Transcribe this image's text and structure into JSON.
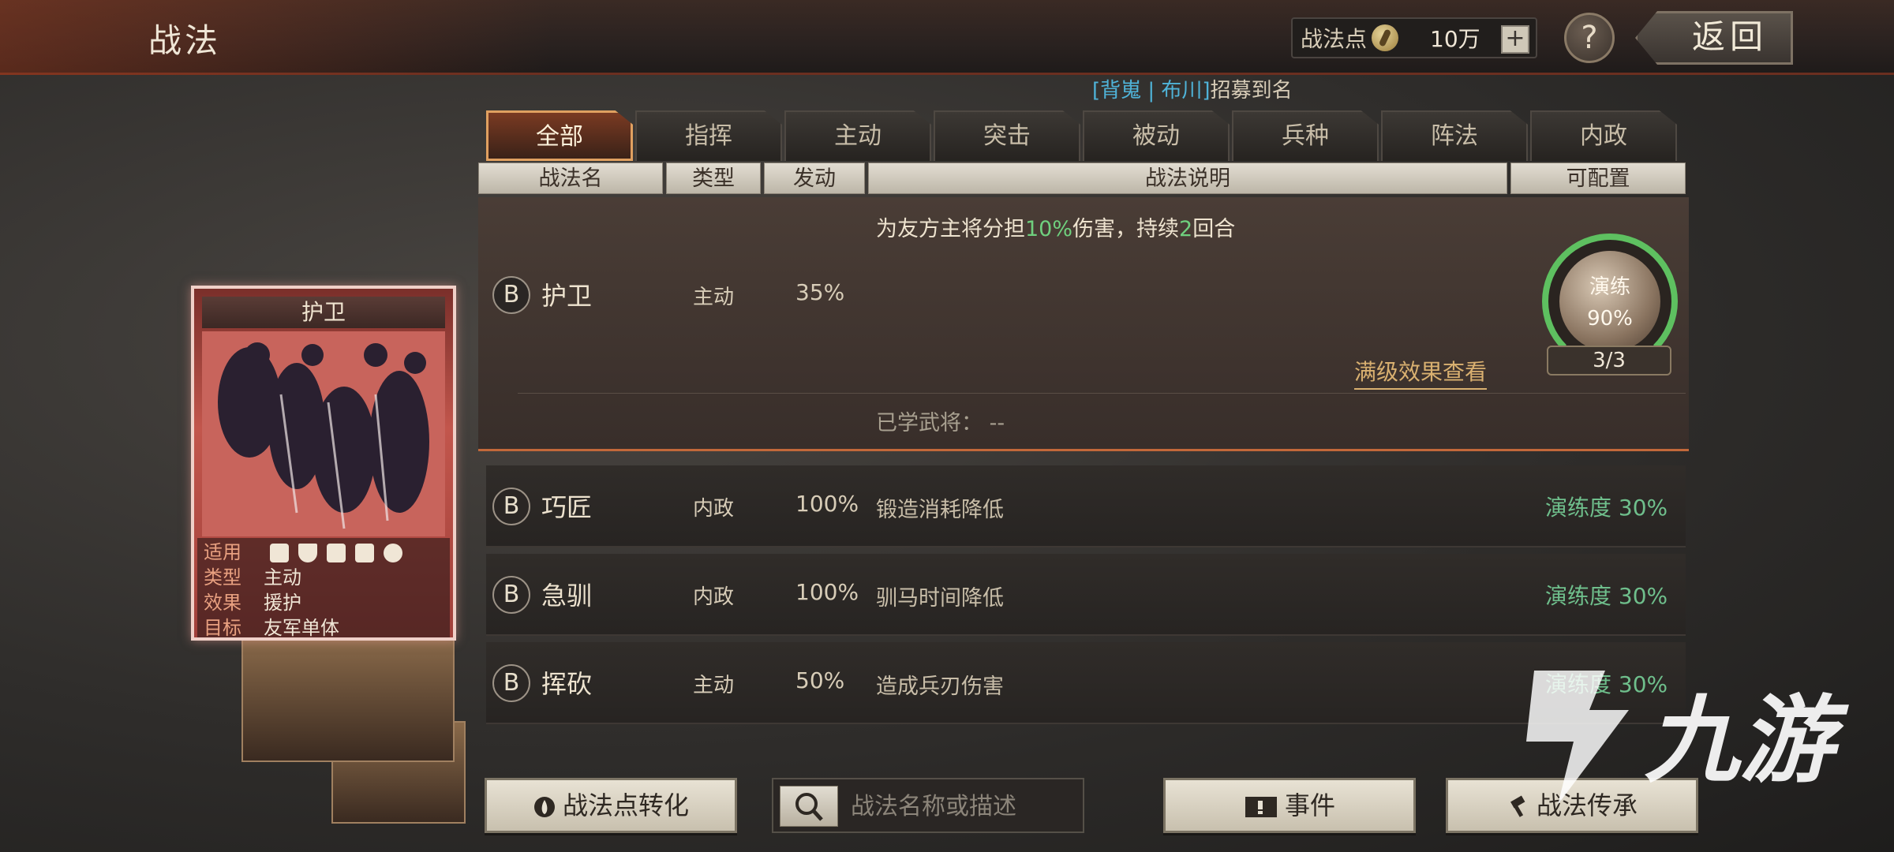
{
  "header": {
    "title": "战法",
    "points_label": "战法点",
    "points_value": "10万",
    "plus": "+",
    "help": "?",
    "back": "返回"
  },
  "ticker": {
    "name": "[背嵬 | 布川]",
    "text": "招募到名"
  },
  "tabs": [
    {
      "label": "全部",
      "active": true
    },
    {
      "label": "指挥"
    },
    {
      "label": "主动"
    },
    {
      "label": "突击"
    },
    {
      "label": "被动"
    },
    {
      "label": "兵种"
    },
    {
      "label": "阵法"
    },
    {
      "label": "内政"
    }
  ],
  "columns": [
    "战法名",
    "类型",
    "发动",
    "战法说明",
    "可配置"
  ],
  "expanded": {
    "grade": "B",
    "name": "护卫",
    "type": "主动",
    "rate": "35%",
    "desc_a": "为友方主将分担",
    "desc_pct": "10%",
    "desc_b": "伤害，持续",
    "desc_turns": "2",
    "desc_c": "回合",
    "full_link": "满级效果查看",
    "learned": "已学武将： --",
    "drill_label": "演练",
    "drill_value": "90%",
    "drill_count": "3/3",
    "drill_progress": 0.9
  },
  "rows": [
    {
      "grade": "B",
      "name": "巧匠",
      "type": "内政",
      "rate": "100%",
      "desc": "锻造消耗降低",
      "prof": "演练度 30%"
    },
    {
      "grade": "B",
      "name": "急驯",
      "type": "内政",
      "rate": "100%",
      "desc": "驯马时间降低",
      "prof": "演练度 30%"
    },
    {
      "grade": "B",
      "name": "挥砍",
      "type": "主动",
      "rate": "50%",
      "desc": "造成兵刃伤害",
      "prof": "演练度 30%"
    }
  ],
  "card": {
    "title": "护卫",
    "apply_label": "适用",
    "type_label": "类型",
    "type_value": "主动",
    "effect_label": "效果",
    "effect_value": "援护",
    "target_label": "目标",
    "target_value": "友军单体"
  },
  "buttons": {
    "convert": "战法点转化",
    "search_placeholder": "战法名称或描述",
    "event": "事件",
    "inherit": "战法传承"
  },
  "watermark": "九游",
  "colors": {
    "accent": "#e0a060",
    "highlight": "#6fd07e",
    "proficiency": "#6fbf8c",
    "link": "#d9b070"
  }
}
